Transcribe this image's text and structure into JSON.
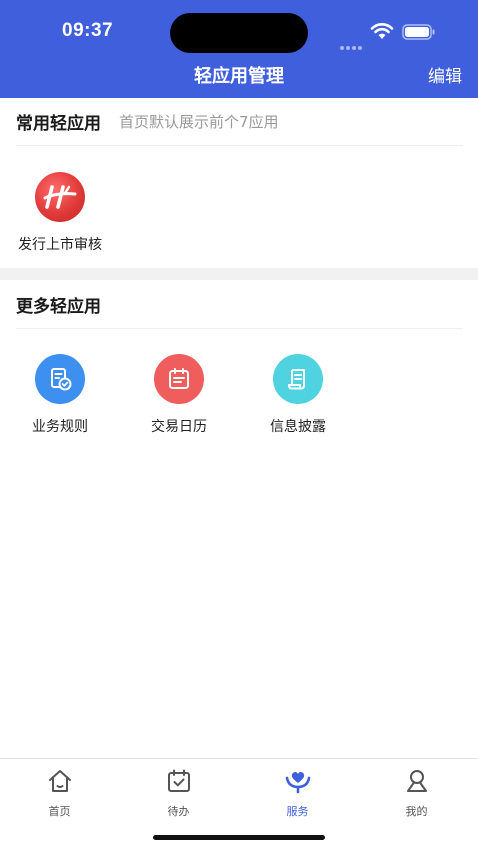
{
  "status": {
    "time": "09:37"
  },
  "header": {
    "title": "轻应用管理",
    "edit_label": "编辑"
  },
  "common": {
    "title": "常用轻应用",
    "subtitle": "首页默认展示前个7应用",
    "apps": [
      {
        "label": "发行上市审核",
        "icon": "issuance-review-logo-icon",
        "color": "#e03a3a"
      }
    ]
  },
  "more": {
    "title": "更多轻应用",
    "apps": [
      {
        "label": "业务规则",
        "icon": "document-check-icon",
        "color": "#3d8ff0"
      },
      {
        "label": "交易日历",
        "icon": "calendar-icon",
        "color": "#ef5d5d"
      },
      {
        "label": "信息披露",
        "icon": "scroll-document-icon",
        "color": "#4fd3e0"
      }
    ]
  },
  "tabbar": {
    "active_color": "#3f5fdc",
    "tabs": [
      {
        "label": "首页",
        "icon": "home-icon"
      },
      {
        "label": "待办",
        "icon": "todo-calendar-icon"
      },
      {
        "label": "服务",
        "icon": "service-heart-icon",
        "active": true
      },
      {
        "label": "我的",
        "icon": "person-icon"
      }
    ]
  }
}
